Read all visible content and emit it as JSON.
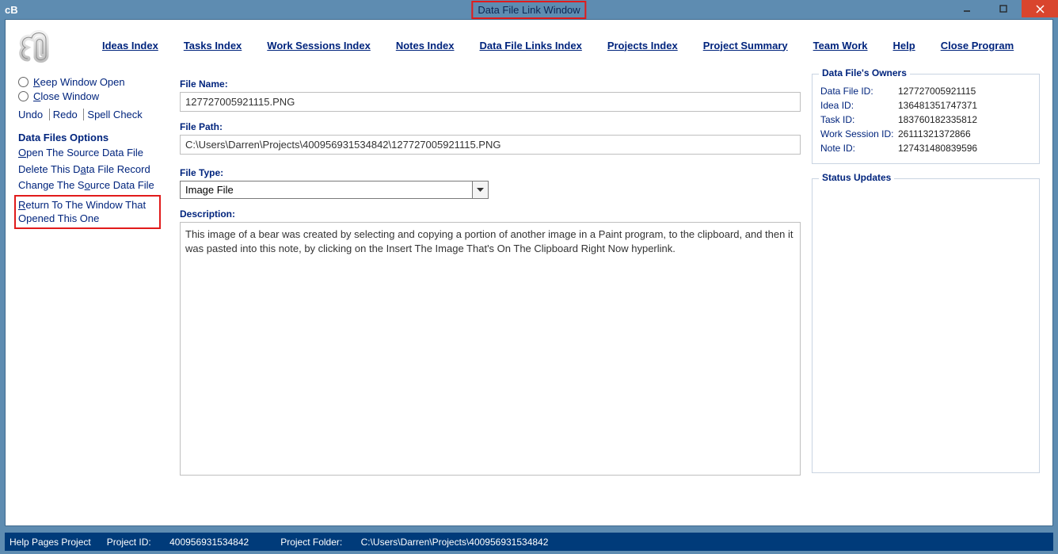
{
  "window": {
    "title": "Data File Link Window",
    "app_abbrev": "cB"
  },
  "menu": {
    "ideas": "Ideas Index",
    "tasks": "Tasks Index",
    "work": "Work Sessions Index",
    "notes": "Notes Index",
    "dfl": "Data File Links Index",
    "projects": "Projects Index",
    "summary": "Project Summary",
    "team": "Team Work",
    "help": "Help",
    "close": "Close Program"
  },
  "sidebar": {
    "keep_open": "eep Window Open",
    "close_window": "lose Window",
    "undo": "Undo",
    "redo": "Redo",
    "spell": "Spell Check",
    "options_header": "Data Files Options",
    "open_source": "pen The Source Data File",
    "delete_record": "Delete This D",
    "delete_record_tail": "ata File Record",
    "change_source": "Change The S",
    "change_source_tail": "ource Data File",
    "return_pre": "R",
    "return_tail": "eturn To The Window That Opened This One"
  },
  "labels": {
    "file_name": "File Name:",
    "file_path": "File Path:",
    "file_type": "File Type:",
    "description": "Description:",
    "owners": "Data File's Owners",
    "status": "Status Updates"
  },
  "fields": {
    "file_name": "127727005921115.PNG",
    "file_path": "C:\\Users\\Darren\\Projects\\400956931534842\\127727005921115.PNG",
    "file_type": "Image File",
    "description": "This image of a bear was created by selecting and copying a portion of another image in a Paint program, to the clipboard, and then it was pasted into this note, by clicking on the Insert The Image That's On The Clipboard Right Now hyperlink."
  },
  "owners": {
    "data_file_id_label": "Data File ID:",
    "data_file_id": "127727005921115",
    "idea_id_label": "Idea ID:",
    "idea_id": "136481351747371",
    "task_id_label": "Task ID:",
    "task_id": "183760182335812",
    "work_id_label": "Work Session ID:",
    "work_id": "26111321372866",
    "note_id_label": "Note ID:",
    "note_id": "127431480839596"
  },
  "status": {
    "left": "Help Pages Project",
    "project_id_label": "Project ID:",
    "project_id": "400956931534842",
    "folder_label": "Project Folder:",
    "folder": "C:\\Users\\Darren\\Projects\\400956931534842"
  }
}
